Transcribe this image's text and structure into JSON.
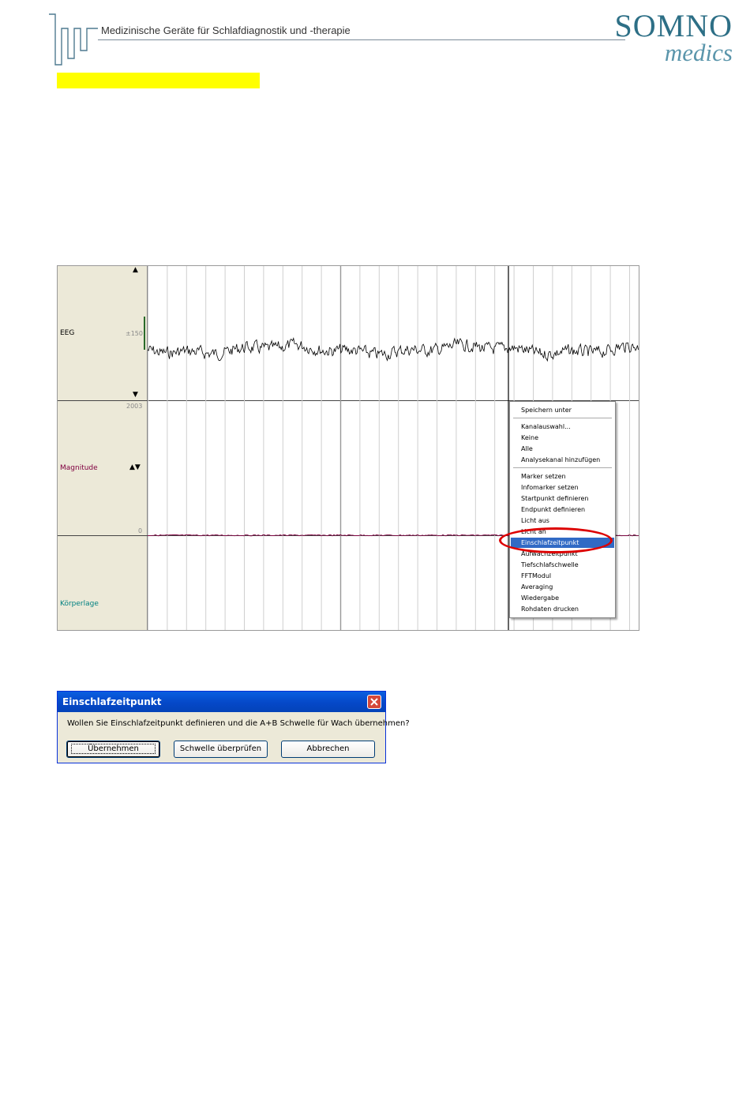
{
  "header": {
    "tagline": "Medizinische Geräte für Schlafdiagnostik und -therapie",
    "brand_line1": "SOMNO",
    "brand_line2": "medics"
  },
  "colors": {
    "brand": "#2d6f86",
    "highlight": "#ffff00",
    "selection": "#316ac5",
    "annotation": "#dd0000"
  },
  "viewer": {
    "channels": [
      {
        "label": "EEG",
        "scale": "±150",
        "color": "#000000"
      },
      {
        "label": "Magnitude",
        "scale_top": "2003",
        "scale_bottom": "0",
        "color": "#800040"
      },
      {
        "label": "Körperlage",
        "color": "#008080"
      }
    ]
  },
  "context_menu": {
    "items": [
      "Speichern unter",
      "Kanalauswahl...",
      "Keine",
      "Alle",
      "Analysekanal hinzufügen",
      "Marker setzen",
      "Infomarker setzen",
      "Startpunkt definieren",
      "Endpunkt definieren",
      "Licht aus",
      "Licht an",
      "Einschlafzeitpunkt",
      "Aufwachzeitpunkt",
      "Tiefschlafschwelle",
      "FFTModul",
      "Averaging",
      "Wiedergabe",
      "Rohdaten drucken"
    ],
    "selected": "Einschlafzeitpunkt"
  },
  "dialog": {
    "title": "Einschlafzeitpunkt",
    "message": "Wollen Sie Einschlafzeitpunkt definieren und die A+B Schwelle für Wach übernehmen?",
    "buttons": [
      "Übernehmen",
      "Schwelle überprüfen",
      "Abbrechen"
    ]
  }
}
